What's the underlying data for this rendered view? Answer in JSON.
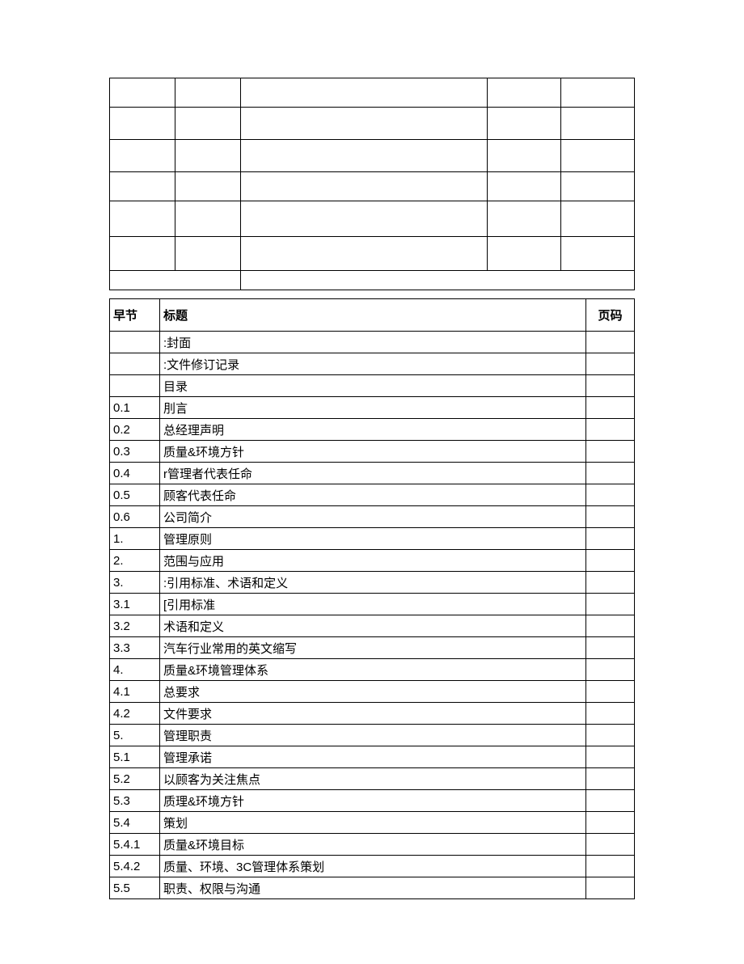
{
  "toc_headers": {
    "section": "早节",
    "title": "标题",
    "page": "页码"
  },
  "toc_rows": [
    {
      "section": "",
      "title": ":封面",
      "page": ""
    },
    {
      "section": "",
      "title": ":文件修订记录",
      "page": ""
    },
    {
      "section": "",
      "title": "目录",
      "page": ""
    },
    {
      "section": "0.1",
      "title": "刖言",
      "page": ""
    },
    {
      "section": "0.2",
      "title": "总经理声明",
      "page": ""
    },
    {
      "section": "0.3",
      "title": "质量&环境方针",
      "page": ""
    },
    {
      "section": "0.4",
      "title": "r管理者代表任命",
      "page": ""
    },
    {
      "section": "0.5",
      "title": "顾客代表任命",
      "page": ""
    },
    {
      "section": "0.6",
      "title": "公司简介",
      "page": ""
    },
    {
      "section": "1.",
      "title": "管理原则",
      "page": ""
    },
    {
      "section": "2.",
      "title": "范围与应用",
      "page": ""
    },
    {
      "section": "3.",
      "title": ":引用标准、术语和定义",
      "page": ""
    },
    {
      "section": "3.1",
      "title": "[引用标准",
      "page": ""
    },
    {
      "section": "3.2",
      "title": "术语和定义",
      "page": ""
    },
    {
      "section": "3.3",
      "title": "汽车行业常用的英文缩写",
      "page": ""
    },
    {
      "section": "4.",
      "title": "质量&环境管理体系",
      "page": ""
    },
    {
      "section": "4.1",
      "title": "总要求",
      "page": ""
    },
    {
      "section": "4.2",
      "title": "文件要求",
      "page": ""
    },
    {
      "section": "5.",
      "title": "管理职责",
      "page": ""
    },
    {
      "section": "5.1",
      "title": "管理承诺",
      "page": ""
    },
    {
      "section": "5.2",
      "title": "以顾客为关注焦点",
      "page": ""
    },
    {
      "section": "5.3",
      "title": "质理&环境方针",
      "page": ""
    },
    {
      "section": "5.4",
      "title": "策划",
      "page": ""
    },
    {
      "section": "5.4.1",
      "title": "质量&环境目标",
      "page": ""
    },
    {
      "section": "5.4.2",
      "title": "质量、环境、3C管理体系策划",
      "page": ""
    },
    {
      "section": "5.5",
      "title": "职责、权限与沟通",
      "page": ""
    }
  ]
}
